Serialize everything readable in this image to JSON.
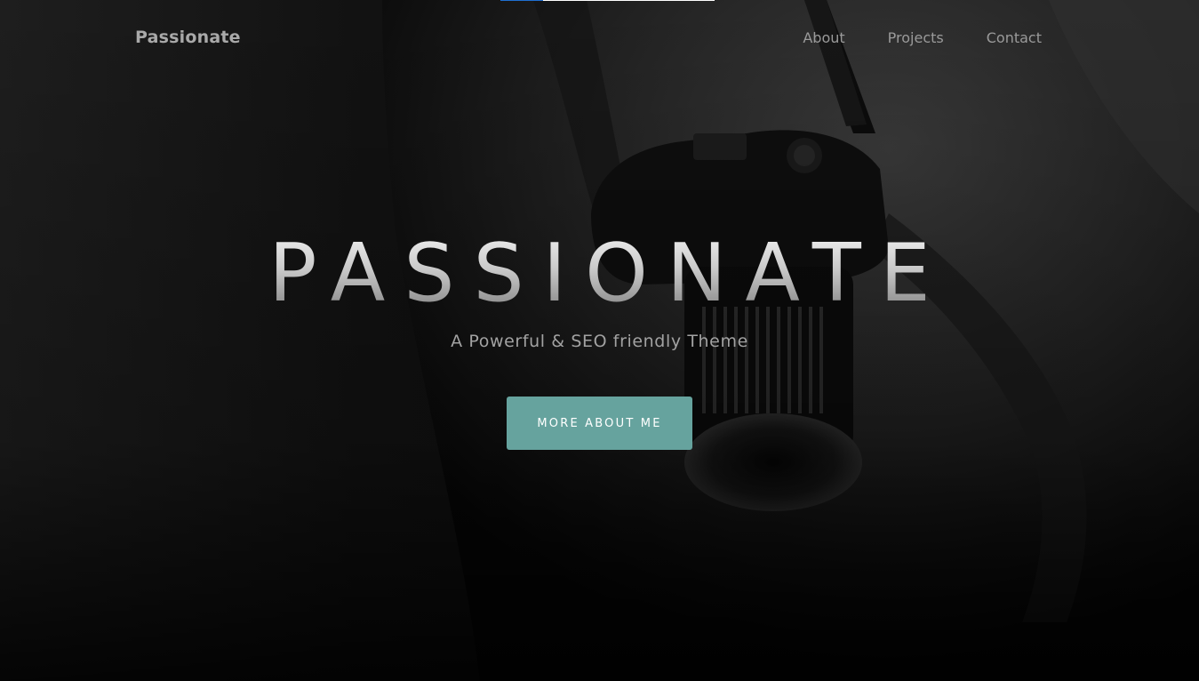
{
  "site": {
    "logo": "Passionate"
  },
  "nav": {
    "items": [
      {
        "label": "About"
      },
      {
        "label": "Projects"
      },
      {
        "label": "Contact"
      }
    ]
  },
  "hero": {
    "title": "PASSIONATE",
    "subtitle": "A Powerful & SEO friendly Theme",
    "cta_label": "MORE ABOUT ME",
    "background_image": "dark photo of a person in a hoodie holding a camera"
  },
  "progress": {
    "fraction": 0.2
  },
  "colors": {
    "accent": "#66a39e",
    "background": "#0b0b0b",
    "progress_fill": "#1f6fd1"
  }
}
